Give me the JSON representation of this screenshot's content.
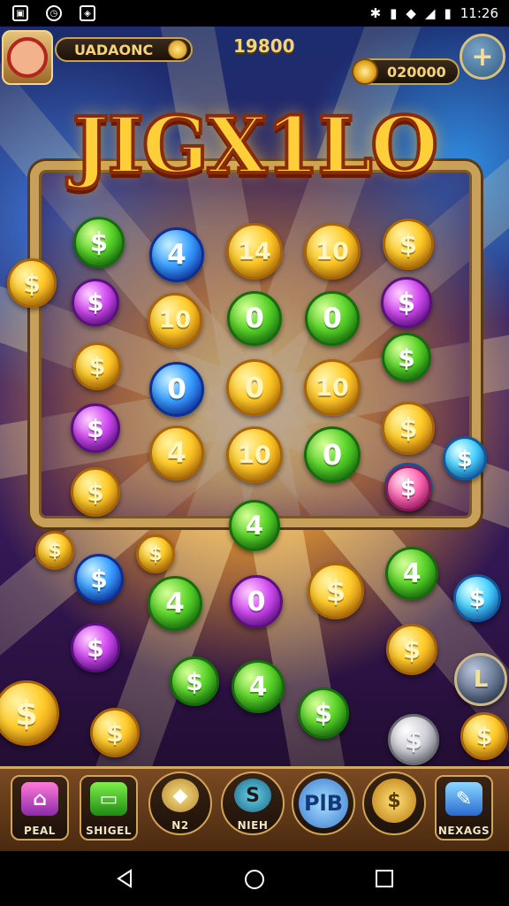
{
  "status_bar": {
    "time": "11:26"
  },
  "hud": {
    "player_name": "UADAONC",
    "score": "19800",
    "coins": "020000",
    "add_button": "+"
  },
  "title": "JIGX1LO",
  "board_coins": [
    {
      "label": "$",
      "color": "green"
    },
    {
      "label": "4",
      "color": "blue"
    },
    {
      "label": "14",
      "color": "gold"
    },
    {
      "label": "10",
      "color": "gold"
    },
    {
      "label": "$",
      "color": "gold"
    },
    {
      "label": "$",
      "color": "purple"
    },
    {
      "label": "10",
      "color": "gold"
    },
    {
      "label": "0",
      "color": "green"
    },
    {
      "label": "0",
      "color": "green"
    },
    {
      "label": "$",
      "color": "purple"
    },
    {
      "label": "$",
      "color": "gold"
    },
    {
      "label": "0",
      "color": "blue"
    },
    {
      "label": "0",
      "color": "gold"
    },
    {
      "label": "10",
      "color": "gold"
    },
    {
      "label": "$",
      "color": "green"
    },
    {
      "label": "$",
      "color": "purple"
    },
    {
      "label": "4",
      "color": "gold"
    },
    {
      "label": "10",
      "color": "gold"
    },
    {
      "label": "0",
      "color": "green"
    },
    {
      "label": "$",
      "color": "gold"
    },
    {
      "label": "$",
      "color": "gold"
    },
    {
      "label": "4",
      "color": "green"
    },
    {
      "label": "$",
      "color": "cyan"
    }
  ],
  "falling_coins": [
    {
      "label": "$",
      "color": "gold"
    },
    {
      "label": "$",
      "color": "blue"
    },
    {
      "label": "$",
      "color": "gold"
    },
    {
      "label": "4",
      "color": "green"
    },
    {
      "label": "0",
      "color": "purple"
    },
    {
      "label": "$",
      "color": "gold"
    },
    {
      "label": "$",
      "color": "gold"
    },
    {
      "label": "4",
      "color": "green"
    },
    {
      "label": "$",
      "color": "cyan"
    },
    {
      "label": "$",
      "color": "purple"
    },
    {
      "label": "$",
      "color": "green"
    },
    {
      "label": "4",
      "color": "green"
    },
    {
      "label": "$",
      "color": "green"
    },
    {
      "label": "$",
      "color": "gold"
    },
    {
      "label": "$",
      "color": "gold"
    },
    {
      "label": "$",
      "color": "silver"
    },
    {
      "label": "$",
      "color": "gold"
    },
    {
      "label": "$",
      "color": "gold"
    },
    {
      "label": "$",
      "color": "pink"
    },
    {
      "label": "$",
      "color": "cyan"
    }
  ],
  "side_button": "L",
  "bottom_buttons": [
    {
      "label": "PEAL",
      "icon": "house-icon"
    },
    {
      "label": "SHIGEL",
      "icon": "card-icon"
    },
    {
      "label": "N2",
      "icon": "gem-icon"
    },
    {
      "label": "NIEH",
      "icon": "refresh-icon",
      "glyph": "S"
    },
    {
      "label": "",
      "icon": "plb-icon",
      "glyph": "PlB"
    },
    {
      "label": "",
      "icon": "gold-block-icon"
    },
    {
      "label": "NEXAGS",
      "icon": "pen-icon"
    }
  ],
  "colors": {
    "gold": "#ffcb2a",
    "green": "#5bd42a",
    "blue": "#3aa0ff",
    "purple": "#d14cf0",
    "cyan": "#4ad2ff",
    "pink": "#ff6ab4",
    "silver": "#cfcfd6",
    "frame": "#c9a05a"
  }
}
